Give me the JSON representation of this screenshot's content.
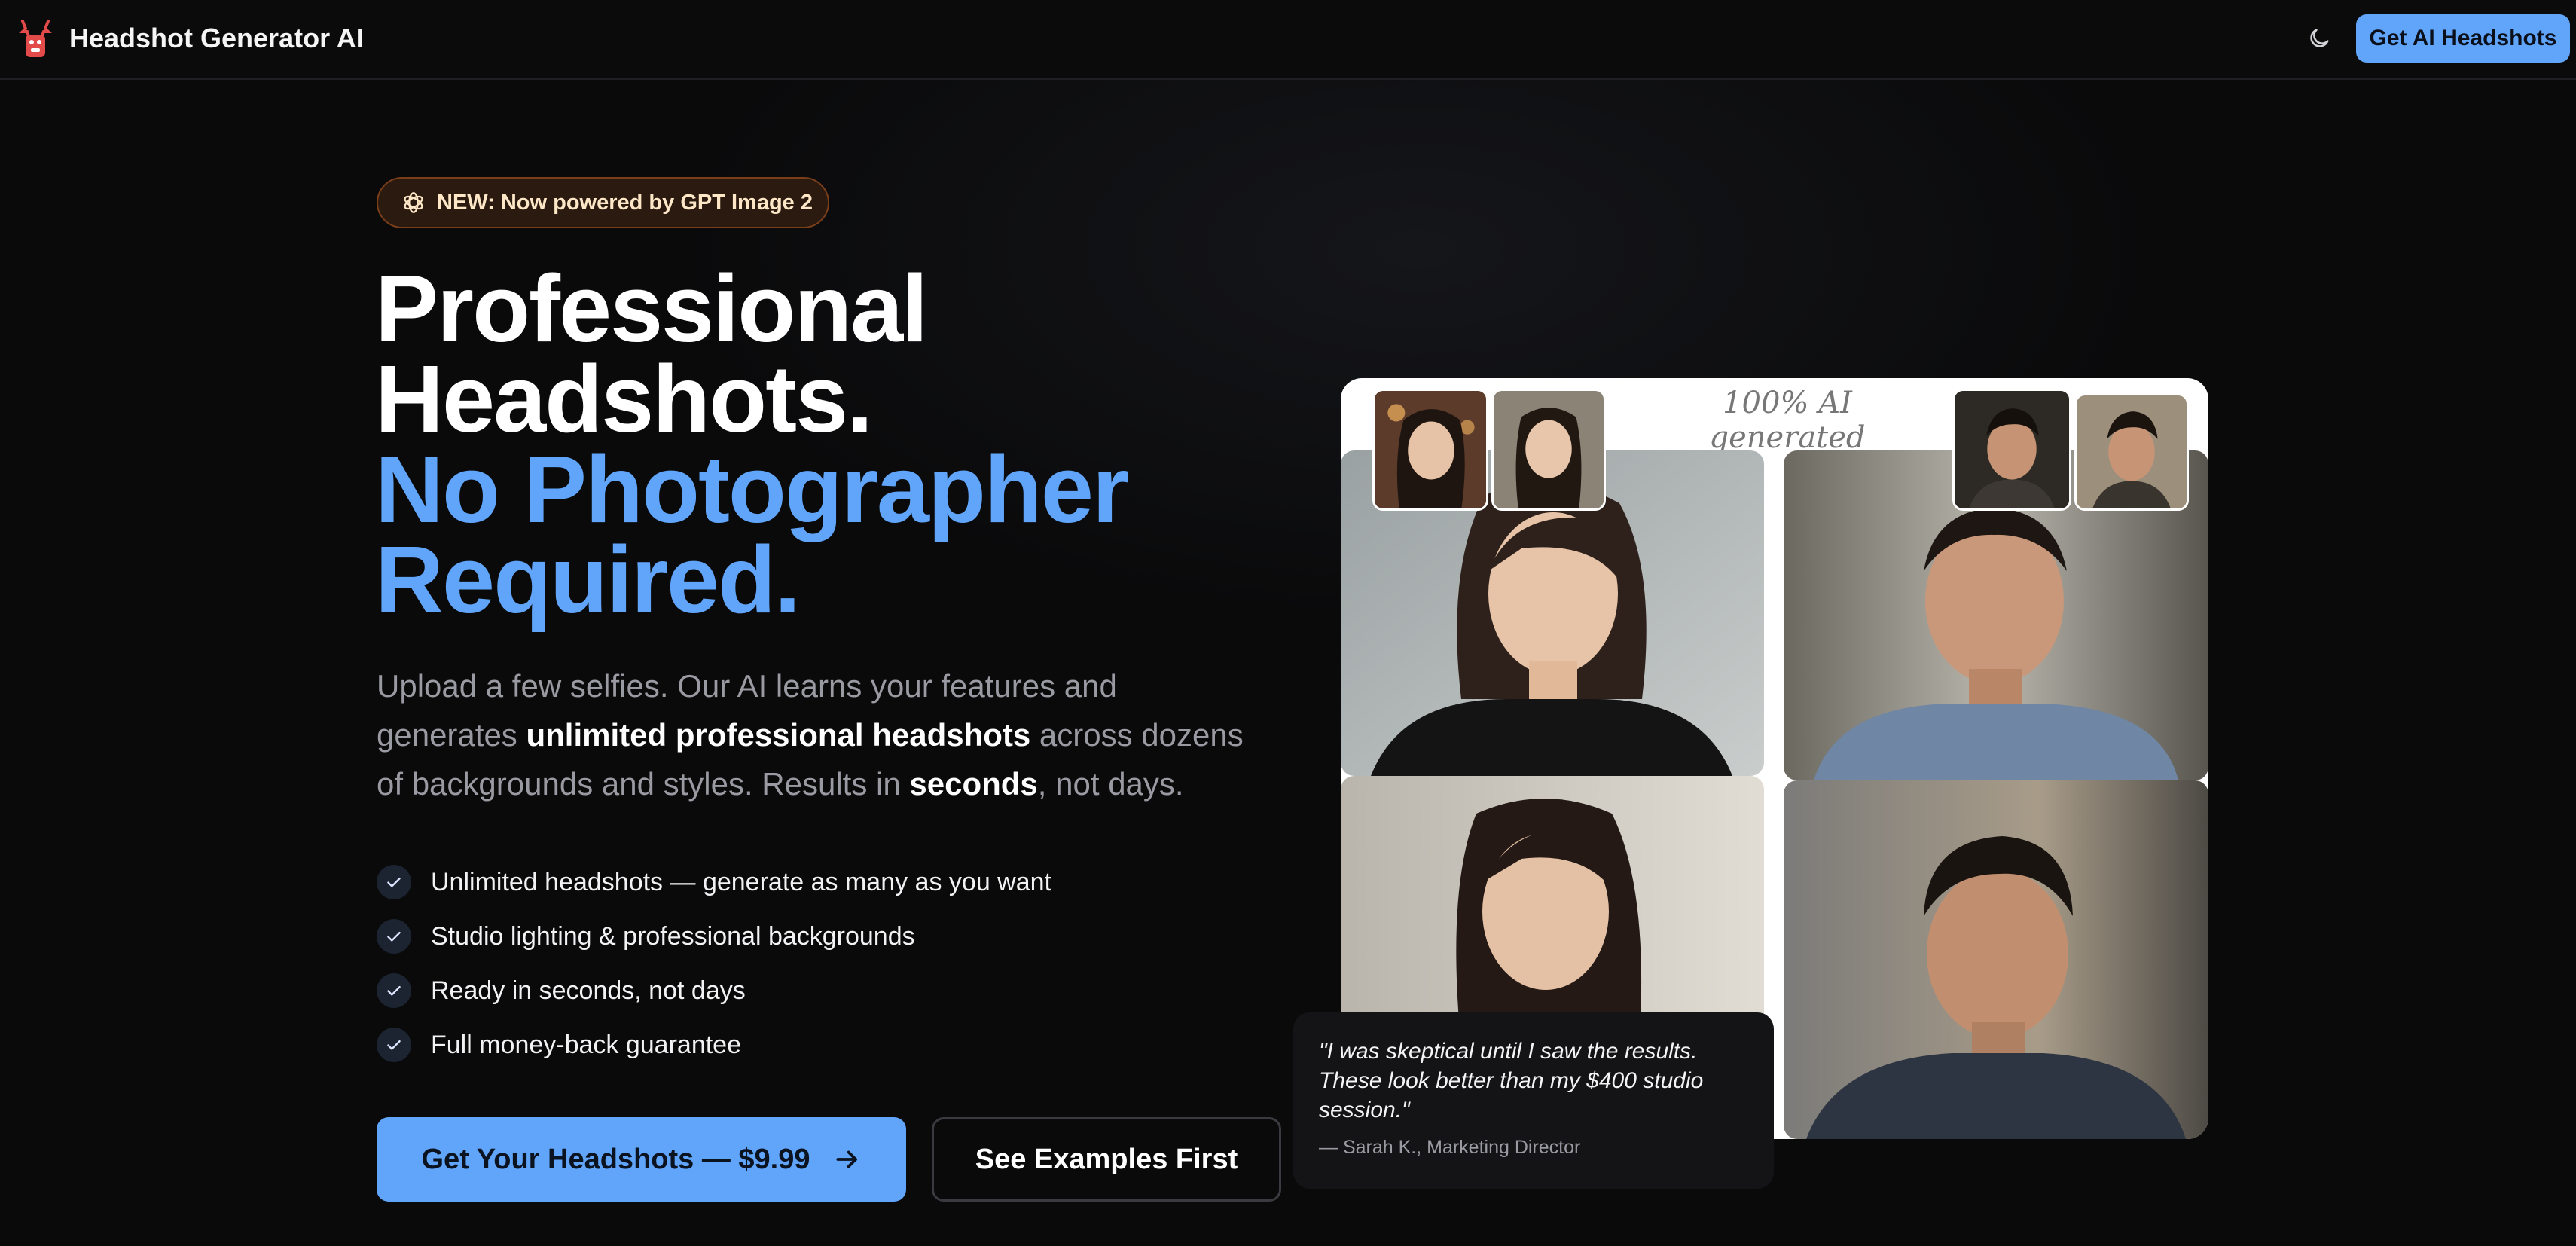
{
  "nav": {
    "brand": "Headshot Generator AI",
    "theme_toggle_icon": "moon-icon",
    "cta_label": "Get AI Headshots"
  },
  "hero": {
    "badge": "NEW: Now powered by GPT Image 2",
    "title_line1": "Professional",
    "title_line2": "Headshots.",
    "title_line3": "No Photographer",
    "title_line4": "Required.",
    "subtitle": {
      "part1": "Upload a few selfies. Our AI learns your features and generates ",
      "bold1": "unlimited professional headshots",
      "part2": " across dozens of backgrounds and styles. Results in ",
      "bold2": "seconds",
      "part3": ", not days."
    },
    "features": [
      "Unlimited headshots — generate as many as you want",
      "Studio lighting & professional backgrounds",
      "Ready in seconds, not days",
      "Full money-back guarantee"
    ],
    "primary_button": "Get Your Headshots — $9.99",
    "secondary_button": "See Examples First"
  },
  "showcase": {
    "label": "100% AI generated"
  },
  "testimonial": {
    "quote": "\"I was skeptical until I saw the results. These look better than my $400 studio session.\"",
    "author": "— Sarah K., Marketing Director"
  },
  "colors": {
    "background": "#0a0a0b",
    "accent": "#60a5fa",
    "badge_bg": "#2b1a10",
    "badge_border": "#7a3e19"
  }
}
